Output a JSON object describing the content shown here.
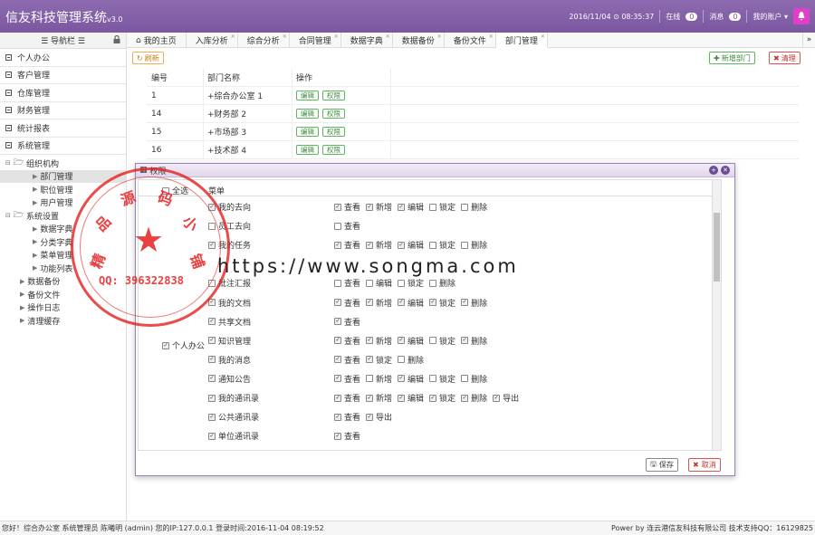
{
  "topbar": {
    "app_title": "信友科技管理系统",
    "version": "v3.0",
    "datetime": "2016/11/04 ⊙ 08:35:37",
    "online_label": "在线",
    "online_count": "0",
    "message_label": "消息",
    "message_count": "0",
    "account_label": "我的账户 ▾"
  },
  "sidebar": {
    "header": "☰ 导航栏 ☰",
    "modules": [
      "个人办公",
      "客户管理",
      "仓库管理",
      "财务管理",
      "统计报表",
      "系统管理"
    ],
    "tree": {
      "org": "组织机构",
      "org_children": [
        "部门管理",
        "职位管理",
        "用户管理"
      ],
      "settings": "系统设置",
      "settings_children": [
        "数据字典",
        "分类字典",
        "菜单管理",
        "功能列表"
      ],
      "leaves": [
        "数据备份",
        "备份文件",
        "操作日志",
        "清理缓存"
      ]
    }
  },
  "tabs": [
    "我的主页",
    "入库分析",
    "综合分析",
    "合同管理",
    "数据字典",
    "数据备份",
    "备份文件",
    "部门管理"
  ],
  "toolbar": {
    "refresh": "刷新",
    "add_dept": "新增部门",
    "clear": "清理"
  },
  "grid": {
    "headers": [
      "编号",
      "部门名称",
      "操作"
    ],
    "rows": [
      {
        "id": "1",
        "name": "+综合办公室 1"
      },
      {
        "id": "14",
        "name": "+财务部 2"
      },
      {
        "id": "15",
        "name": "+市场部 3"
      },
      {
        "id": "16",
        "name": "+技术部 4"
      }
    ],
    "edit_label": "编辑",
    "perm_label": "权限"
  },
  "modal": {
    "title": "权限",
    "select_all": "全选",
    "menu_header": "菜单",
    "group_label": "个人办公",
    "rows": [
      {
        "menu": "我的去向",
        "checked": true,
        "ops": [
          [
            "查看",
            true
          ],
          [
            "新增",
            true
          ],
          [
            "编辑",
            true
          ],
          [
            "锁定",
            false
          ],
          [
            "删除",
            false
          ]
        ]
      },
      {
        "menu": "员工去向",
        "checked": false,
        "ops": [
          [
            "查看",
            false
          ]
        ]
      },
      {
        "menu": "我的任务",
        "checked": true,
        "ops": [
          [
            "查看",
            true
          ],
          [
            "新增",
            true
          ],
          [
            "编辑",
            true
          ],
          [
            "锁定",
            false
          ],
          [
            "删除",
            false
          ]
        ]
      },
      {
        "menu": "",
        "checked": false,
        "ops": []
      },
      {
        "menu": "批注汇报",
        "checked": false,
        "ops": [
          [
            "查看",
            false
          ],
          [
            "编辑",
            false
          ],
          [
            "锁定",
            false
          ],
          [
            "删除",
            false
          ]
        ]
      },
      {
        "menu": "我的文档",
        "checked": true,
        "ops": [
          [
            "查看",
            true
          ],
          [
            "新增",
            true
          ],
          [
            "编辑",
            true
          ],
          [
            "锁定",
            true
          ],
          [
            "删除",
            true
          ]
        ]
      },
      {
        "menu": "共享文档",
        "checked": true,
        "ops": [
          [
            "查看",
            true
          ]
        ]
      },
      {
        "menu": "知识管理",
        "checked": true,
        "ops": [
          [
            "查看",
            true
          ],
          [
            "新增",
            true
          ],
          [
            "编辑",
            true
          ],
          [
            "锁定",
            false
          ],
          [
            "删除",
            true
          ]
        ]
      },
      {
        "menu": "我的消息",
        "checked": true,
        "ops": [
          [
            "查看",
            true
          ],
          [
            "锁定",
            true
          ],
          [
            "删除",
            false
          ]
        ]
      },
      {
        "menu": "通知公告",
        "checked": true,
        "ops": [
          [
            "查看",
            true
          ],
          [
            "新增",
            false
          ],
          [
            "编辑",
            true
          ],
          [
            "锁定",
            false
          ],
          [
            "删除",
            false
          ]
        ]
      },
      {
        "menu": "我的通讯录",
        "checked": true,
        "ops": [
          [
            "查看",
            true
          ],
          [
            "新增",
            true
          ],
          [
            "编辑",
            true
          ],
          [
            "锁定",
            true
          ],
          [
            "删除",
            true
          ],
          [
            "导出",
            true
          ]
        ]
      },
      {
        "menu": "公共通讯录",
        "checked": true,
        "ops": [
          [
            "查看",
            true
          ],
          [
            "导出",
            true
          ]
        ]
      },
      {
        "menu": "单位通讯录",
        "checked": true,
        "ops": [
          [
            "查看",
            true
          ]
        ]
      }
    ],
    "save": "保存",
    "cancel": "取消"
  },
  "statusbar": {
    "left": "您好！综合办公室 系统管理员 陈曦明 (admin) 您的IP:127.0.0.1 登录时间:2016-11-04 08:19:52",
    "right": "Power by 连云港信友科技有限公司 技术支持QQ：16129825"
  },
  "overlay": {
    "stamp_chars": [
      "精",
      "品",
      "源",
      "码",
      "小",
      "铺"
    ],
    "stamp_qq": "QQ: 396322838",
    "watermark_url": "https://www.songma.com"
  },
  "colors": {
    "brand": "#7a579f",
    "success": "#5cb85c",
    "danger": "#d9534f",
    "warn": "#f0ad4e",
    "stamp": "#e61e1e"
  }
}
